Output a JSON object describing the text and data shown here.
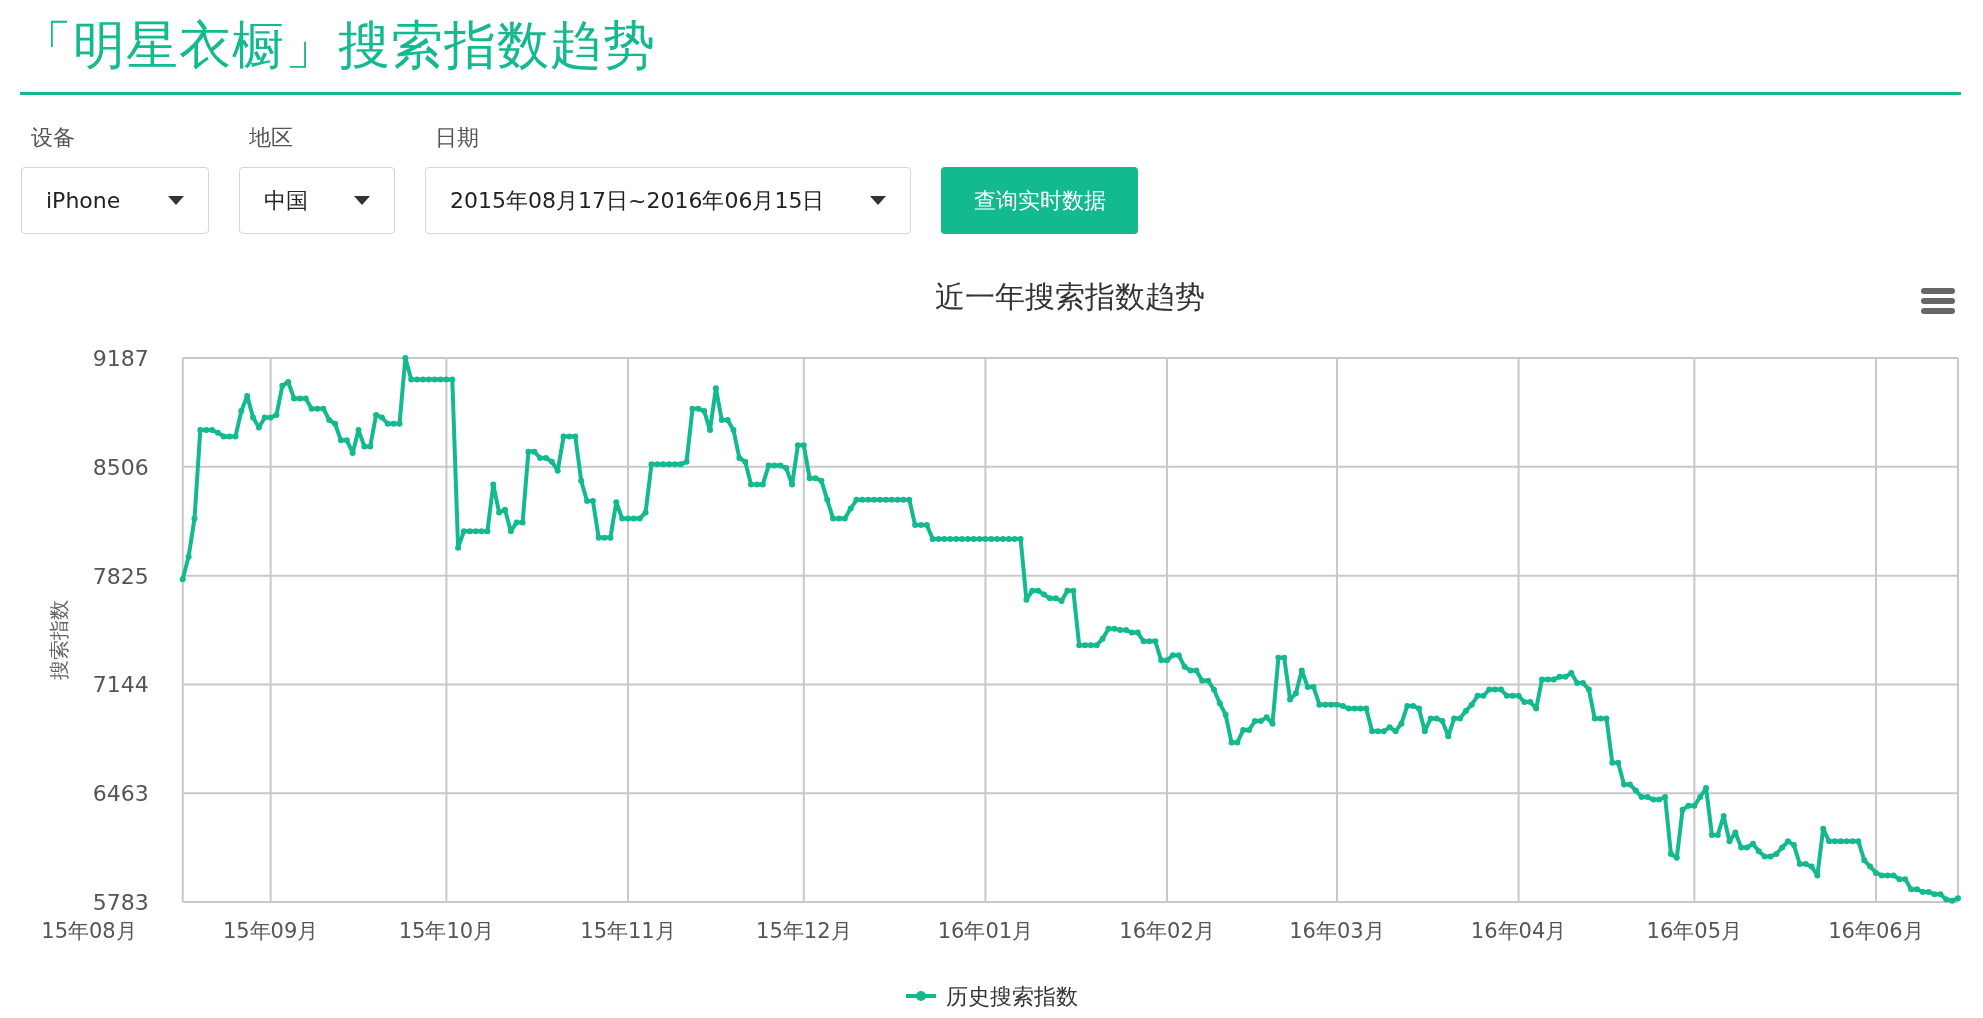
{
  "page_title": "「明星衣橱」搜索指数趋势",
  "filters": [
    {
      "label": "设备",
      "value": "iPhone"
    },
    {
      "label": "地区",
      "value": "中国"
    },
    {
      "label": "日期",
      "value": "2015年08月17日~2016年06月15日"
    }
  ],
  "query_button": "查询实时数据",
  "chart": {
    "chart_data": {
      "type": "line",
      "title": "近一年搜索指数趋势",
      "ylabel": "搜索指数",
      "categories": [
        "15年08月",
        null,
        null,
        null,
        null,
        null,
        null,
        null,
        null,
        null,
        null,
        null,
        null,
        null,
        null,
        null,
        null,
        null,
        null,
        null,
        null,
        null,
        null,
        null,
        null,
        null,
        null,
        null,
        null,
        null,
        null,
        "15年09月",
        null,
        null,
        null,
        null,
        null,
        null,
        null,
        null,
        null,
        null,
        null,
        null,
        null,
        null,
        null,
        null,
        null,
        null,
        null,
        null,
        null,
        null,
        null,
        null,
        null,
        null,
        null,
        null,
        null,
        "15年10月",
        null,
        null,
        null,
        null,
        null,
        null,
        null,
        null,
        null,
        null,
        null,
        null,
        null,
        null,
        null,
        null,
        null,
        null,
        null,
        null,
        null,
        null,
        null,
        null,
        null,
        null,
        null,
        null,
        null,
        null,
        "15年11月",
        null,
        null,
        null,
        null,
        null,
        null,
        null,
        null,
        null,
        null,
        null,
        null,
        null,
        null,
        null,
        null,
        null,
        null,
        null,
        null,
        null,
        null,
        null,
        null,
        null,
        null,
        null,
        null,
        null,
        "15年12月",
        null,
        null,
        null,
        null,
        null,
        null,
        null,
        null,
        null,
        null,
        null,
        null,
        null,
        null,
        null,
        null,
        null,
        null,
        null,
        null,
        null,
        null,
        null,
        null,
        null,
        null,
        null,
        null,
        null,
        null,
        "16年01月",
        null,
        null,
        null,
        null,
        null,
        null,
        null,
        null,
        null,
        null,
        null,
        null,
        null,
        null,
        null,
        null,
        null,
        null,
        null,
        null,
        null,
        null,
        null,
        null,
        null,
        null,
        null,
        null,
        null,
        null,
        "16年02月",
        null,
        null,
        null,
        null,
        null,
        null,
        null,
        null,
        null,
        null,
        null,
        null,
        null,
        null,
        null,
        null,
        null,
        null,
        null,
        null,
        null,
        null,
        null,
        null,
        null,
        null,
        null,
        null,
        "16年03月",
        null,
        null,
        null,
        null,
        null,
        null,
        null,
        null,
        null,
        null,
        null,
        null,
        null,
        null,
        null,
        null,
        null,
        null,
        null,
        null,
        null,
        null,
        null,
        null,
        null,
        null,
        null,
        null,
        null,
        null,
        "16年04月",
        null,
        null,
        null,
        null,
        null,
        null,
        null,
        null,
        null,
        null,
        null,
        null,
        null,
        null,
        null,
        null,
        null,
        null,
        null,
        null,
        null,
        null,
        null,
        null,
        null,
        null,
        null,
        null,
        null,
        "16年05月",
        null,
        null,
        null,
        null,
        null,
        null,
        null,
        null,
        null,
        null,
        null,
        null,
        null,
        null,
        null,
        null,
        null,
        null,
        null,
        null,
        null,
        null,
        null,
        null,
        null,
        null,
        null,
        null,
        null,
        null,
        "16年06月",
        null,
        null,
        null,
        null,
        null,
        null,
        null,
        null,
        null,
        null,
        null,
        null,
        null,
        null
      ],
      "series": [
        {
          "name": "历史搜索指数",
          "color": "#13b98f",
          "marker": true,
          "values": [
            null,
            null,
            null,
            null,
            null,
            null,
            null,
            null,
            null,
            null,
            null,
            null,
            null,
            null,
            null,
            null,
            7802,
            7944,
            8182,
            8736,
            8736,
            8736,
            8720,
            8696,
            8696,
            8696,
            8855,
            8950,
            8815,
            8752,
            8815,
            8815,
            8831,
            9013,
            9037,
            8934,
            8934,
            8934,
            8870,
            8870,
            8870,
            8799,
            8775,
            8672,
            8672,
            8593,
            8736,
            8633,
            8633,
            8831,
            8815,
            8775,
            8775,
            8775,
            9187,
            9052,
            9052,
            9052,
            9052,
            9052,
            9052,
            9052,
            9052,
            8000,
            8103,
            8103,
            8103,
            8103,
            8103,
            8395,
            8221,
            8237,
            8103,
            8158,
            8158,
            8601,
            8601,
            8562,
            8562,
            8538,
            8482,
            8696,
            8696,
            8696,
            8419,
            8292,
            8292,
            8063,
            8063,
            8063,
            8285,
            8182,
            8182,
            8182,
            8182,
            8221,
            8522,
            8522,
            8522,
            8522,
            8522,
            8522,
            8538,
            8870,
            8870,
            8855,
            8736,
            8997,
            8799,
            8799,
            8736,
            8562,
            8538,
            8395,
            8395,
            8395,
            8514,
            8514,
            8514,
            8498,
            8395,
            8641,
            8641,
            8435,
            8435,
            8419,
            8300,
            8182,
            8182,
            8182,
            8245,
            8300,
            8300,
            8300,
            8300,
            8300,
            8300,
            8300,
            8300,
            8300,
            8300,
            8142,
            8142,
            8142,
            8055,
            8055,
            8055,
            8055,
            8055,
            8055,
            8055,
            8055,
            8055,
            8055,
            8055,
            8055,
            8055,
            8055,
            8055,
            8055,
            7675,
            7730,
            7730,
            7707,
            7683,
            7683,
            7667,
            7730,
            7730,
            7390,
            7390,
            7390,
            7390,
            7430,
            7493,
            7493,
            7485,
            7485,
            7469,
            7469,
            7414,
            7414,
            7414,
            7295,
            7295,
            7327,
            7327,
            7255,
            7232,
            7232,
            7168,
            7168,
            7113,
            7026,
            6955,
            6781,
            6781,
            6860,
            6860,
            6915,
            6915,
            6939,
            6899,
            7311,
            7311,
            7050,
            7089,
            7232,
            7129,
            7129,
            7018,
            7018,
            7018,
            7018,
            7010,
            6994,
            6994,
            6994,
            6994,
            6852,
            6852,
            6852,
            6876,
            6852,
            6899,
            7010,
            7010,
            6994,
            6852,
            6931,
            6931,
            6915,
            6820,
            6931,
            6931,
            6978,
            7018,
            7073,
            7073,
            7113,
            7113,
            7113,
            7073,
            7073,
            7073,
            7034,
            7034,
            6994,
            7176,
            7176,
            7176,
            7192,
            7192,
            7216,
            7153,
            7153,
            7113,
            6931,
            6931,
            6931,
            6654,
            6654,
            6519,
            6519,
            6480,
            6440,
            6440,
            6424,
            6424,
            6440,
            6084,
            6060,
            6361,
            6385,
            6385,
            6440,
            6496,
            6203,
            6203,
            6321,
            6163,
            6218,
            6124,
            6124,
            6147,
            6100,
            6068,
            6068,
            6084,
            6124,
            6163,
            6139,
            6021,
            6021,
            6005,
            5949,
            6242,
            6163,
            6163,
            6163,
            6163,
            6163,
            6163,
            6044,
            6005,
            5965,
            5949,
            5949,
            5949,
            5926,
            5926,
            5862,
            5862,
            5846,
            5846,
            5831,
            5831,
            5799,
            5791,
            5807
          ]
        }
      ],
      "grid": true,
      "ylim": [
        5783,
        9187
      ],
      "yticks": [
        5783,
        6463,
        7144,
        7825,
        8506,
        9187
      ]
    }
  }
}
